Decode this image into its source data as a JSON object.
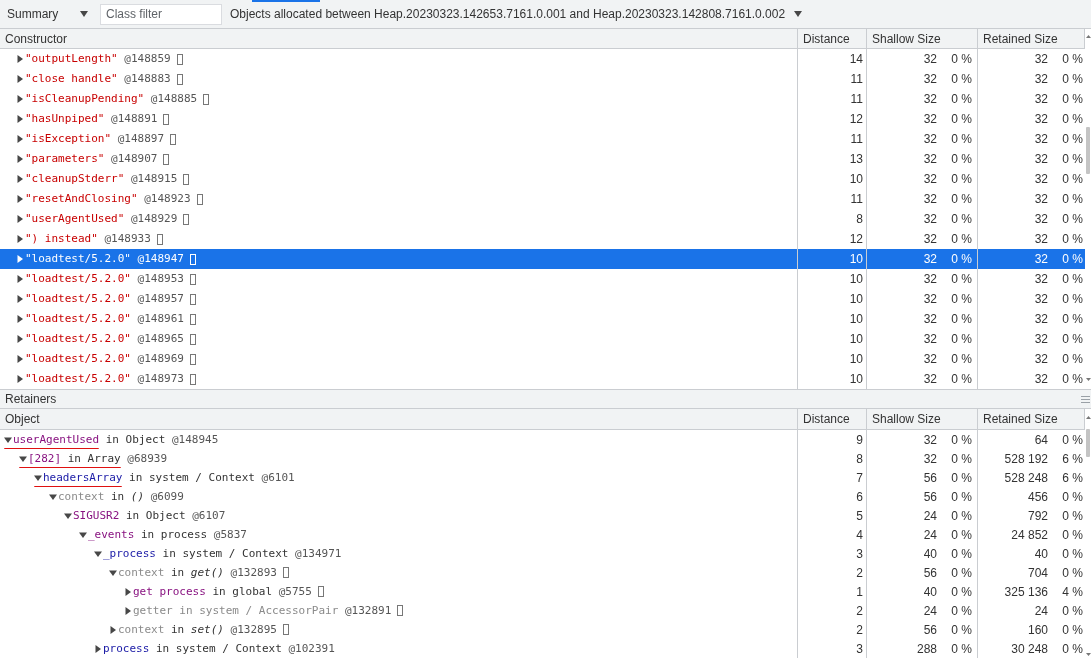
{
  "toolbar": {
    "view_select": "Summary",
    "class_filter": {
      "placeholder": "Class filter"
    },
    "range_select": "Objects allocated between Heap.20230323.142653.7161.0.001 and Heap.20230323.142808.7161.0.002"
  },
  "objects_table": {
    "columns": [
      "Constructor",
      "Distance",
      "Shallow Size",
      "Retained Size"
    ],
    "rows": [
      {
        "name": "\"outputLength\"",
        "id": "@148859",
        "box_icon": true,
        "expanded": false,
        "selected": false,
        "distance": "14",
        "shallow_size": "32",
        "shallow_percent": "0 %",
        "retained_size": "32",
        "retained_percent": "0 %"
      },
      {
        "name": "\"close handle\"",
        "id": "@148883",
        "box_icon": true,
        "expanded": false,
        "selected": false,
        "distance": "11",
        "shallow_size": "32",
        "shallow_percent": "0 %",
        "retained_size": "32",
        "retained_percent": "0 %"
      },
      {
        "name": "\"isCleanupPending\"",
        "id": "@148885",
        "box_icon": true,
        "expanded": false,
        "selected": false,
        "distance": "11",
        "shallow_size": "32",
        "shallow_percent": "0 %",
        "retained_size": "32",
        "retained_percent": "0 %"
      },
      {
        "name": "\"hasUnpiped\"",
        "id": "@148891",
        "box_icon": true,
        "expanded": false,
        "selected": false,
        "distance": "12",
        "shallow_size": "32",
        "shallow_percent": "0 %",
        "retained_size": "32",
        "retained_percent": "0 %"
      },
      {
        "name": "\"isException\"",
        "id": "@148897",
        "box_icon": true,
        "expanded": false,
        "selected": false,
        "distance": "11",
        "shallow_size": "32",
        "shallow_percent": "0 %",
        "retained_size": "32",
        "retained_percent": "0 %"
      },
      {
        "name": "\"parameters\"",
        "id": "@148907",
        "box_icon": true,
        "expanded": false,
        "selected": false,
        "distance": "13",
        "shallow_size": "32",
        "shallow_percent": "0 %",
        "retained_size": "32",
        "retained_percent": "0 %"
      },
      {
        "name": "\"cleanupStderr\"",
        "id": "@148915",
        "box_icon": true,
        "expanded": false,
        "selected": false,
        "distance": "10",
        "shallow_size": "32",
        "shallow_percent": "0 %",
        "retained_size": "32",
        "retained_percent": "0 %"
      },
      {
        "name": "\"resetAndClosing\"",
        "id": "@148923",
        "box_icon": true,
        "expanded": false,
        "selected": false,
        "distance": "11",
        "shallow_size": "32",
        "shallow_percent": "0 %",
        "retained_size": "32",
        "retained_percent": "0 %"
      },
      {
        "name": "\"userAgentUsed\"",
        "id": "@148929",
        "box_icon": true,
        "expanded": false,
        "selected": false,
        "distance": "8",
        "shallow_size": "32",
        "shallow_percent": "0 %",
        "retained_size": "32",
        "retained_percent": "0 %"
      },
      {
        "name": "\") instead\"",
        "id": "@148933",
        "box_icon": true,
        "expanded": false,
        "selected": false,
        "distance": "12",
        "shallow_size": "32",
        "shallow_percent": "0 %",
        "retained_size": "32",
        "retained_percent": "0 %"
      },
      {
        "name": "\"loadtest/5.2.0\"",
        "id": "@148947",
        "box_icon": true,
        "expanded": false,
        "selected": true,
        "distance": "10",
        "shallow_size": "32",
        "shallow_percent": "0 %",
        "retained_size": "32",
        "retained_percent": "0 %"
      },
      {
        "name": "\"loadtest/5.2.0\"",
        "id": "@148953",
        "box_icon": true,
        "expanded": false,
        "selected": false,
        "distance": "10",
        "shallow_size": "32",
        "shallow_percent": "0 %",
        "retained_size": "32",
        "retained_percent": "0 %"
      },
      {
        "name": "\"loadtest/5.2.0\"",
        "id": "@148957",
        "box_icon": true,
        "expanded": false,
        "selected": false,
        "distance": "10",
        "shallow_size": "32",
        "shallow_percent": "0 %",
        "retained_size": "32",
        "retained_percent": "0 %"
      },
      {
        "name": "\"loadtest/5.2.0\"",
        "id": "@148961",
        "box_icon": true,
        "expanded": false,
        "selected": false,
        "distance": "10",
        "shallow_size": "32",
        "shallow_percent": "0 %",
        "retained_size": "32",
        "retained_percent": "0 %"
      },
      {
        "name": "\"loadtest/5.2.0\"",
        "id": "@148965",
        "box_icon": true,
        "expanded": false,
        "selected": false,
        "distance": "10",
        "shallow_size": "32",
        "shallow_percent": "0 %",
        "retained_size": "32",
        "retained_percent": "0 %"
      },
      {
        "name": "\"loadtest/5.2.0\"",
        "id": "@148969",
        "box_icon": true,
        "expanded": false,
        "selected": false,
        "distance": "10",
        "shallow_size": "32",
        "shallow_percent": "0 %",
        "retained_size": "32",
        "retained_percent": "0 %"
      },
      {
        "name": "\"loadtest/5.2.0\"",
        "id": "@148973",
        "box_icon": true,
        "expanded": false,
        "selected": false,
        "distance": "10",
        "shallow_size": "32",
        "shallow_percent": "0 %",
        "retained_size": "32",
        "retained_percent": "0 %"
      }
    ]
  },
  "retainers": {
    "title": "Retainers",
    "columns": [
      "Object",
      "Distance",
      "Shallow Size",
      "Retained Size"
    ],
    "rows": [
      {
        "name": "userAgentUsed",
        "kind": "property",
        "owner": "in Object",
        "id": "@148945",
        "box_icon": false,
        "expanded": true,
        "dimmed": false,
        "name_underlined": true,
        "owner_underlined": false,
        "distance": "9",
        "shallow_size": "32",
        "shallow_percent": "0 %",
        "retained_size": "64",
        "retained_percent": "0 %",
        "children": [
          {
            "name": "[282]",
            "kind": "property",
            "owner": "in Array",
            "id": "@68939",
            "box_icon": false,
            "expanded": true,
            "dimmed": false,
            "name_underlined": true,
            "owner_underlined": true,
            "distance": "8",
            "shallow_size": "32",
            "shallow_percent": "0 %",
            "retained_size": "528 192",
            "retained_percent": "6 %",
            "children": [
              {
                "name": "headersArray",
                "kind": "variable",
                "owner": "in system / Context",
                "id": "@6101",
                "box_icon": false,
                "expanded": true,
                "dimmed": false,
                "name_underlined": true,
                "owner_underlined": false,
                "distance": "7",
                "shallow_size": "56",
                "shallow_percent": "0 %",
                "retained_size": "528 248",
                "retained_percent": "6 %",
                "children": [
                  {
                    "name": "context",
                    "kind": "internal",
                    "owner": "in *()*",
                    "id": "@6099",
                    "box_icon": false,
                    "expanded": true,
                    "dimmed": false,
                    "name_underlined": false,
                    "owner_underlined": false,
                    "distance": "6",
                    "shallow_size": "56",
                    "shallow_percent": "0 %",
                    "retained_size": "456",
                    "retained_percent": "0 %",
                    "children": [
                      {
                        "name": "SIGUSR2",
                        "kind": "property",
                        "owner": "in Object",
                        "id": "@6107",
                        "box_icon": false,
                        "expanded": true,
                        "dimmed": false,
                        "name_underlined": false,
                        "owner_underlined": false,
                        "distance": "5",
                        "shallow_size": "24",
                        "shallow_percent": "0 %",
                        "retained_size": "792",
                        "retained_percent": "0 %",
                        "children": [
                          {
                            "name": "_events",
                            "kind": "property",
                            "owner": "in process",
                            "id": "@5837",
                            "box_icon": false,
                            "expanded": true,
                            "dimmed": false,
                            "name_underlined": false,
                            "owner_underlined": false,
                            "distance": "4",
                            "shallow_size": "24",
                            "shallow_percent": "0 %",
                            "retained_size": "24 852",
                            "retained_percent": "0 %",
                            "children": [
                              {
                                "name": "_process",
                                "kind": "variable",
                                "owner": "in system / Context",
                                "id": "@134971",
                                "box_icon": false,
                                "expanded": true,
                                "dimmed": false,
                                "name_underlined": false,
                                "owner_underlined": false,
                                "distance": "3",
                                "shallow_size": "40",
                                "shallow_percent": "0 %",
                                "retained_size": "40",
                                "retained_percent": "0 %",
                                "children": [
                                  {
                                    "name": "context",
                                    "kind": "internal",
                                    "owner": "in *get()*",
                                    "id": "@132893",
                                    "box_icon": true,
                                    "expanded": true,
                                    "dimmed": false,
                                    "name_underlined": false,
                                    "owner_underlined": false,
                                    "distance": "2",
                                    "shallow_size": "56",
                                    "shallow_percent": "0 %",
                                    "retained_size": "704",
                                    "retained_percent": "0 %",
                                    "children": [
                                      {
                                        "name": "get process",
                                        "kind": "property",
                                        "owner": "in global",
                                        "id": "@5755",
                                        "box_icon": true,
                                        "expanded": false,
                                        "dimmed": false,
                                        "name_underlined": false,
                                        "owner_underlined": false,
                                        "distance": "1",
                                        "shallow_size": "40",
                                        "shallow_percent": "0 %",
                                        "retained_size": "325 136",
                                        "retained_percent": "4 %"
                                      },
                                      {
                                        "name": "getter",
                                        "kind": "internal",
                                        "owner": "in system / AccessorPair",
                                        "id": "@132891",
                                        "box_icon": true,
                                        "expanded": false,
                                        "dimmed": true,
                                        "name_underlined": false,
                                        "owner_underlined": false,
                                        "distance": "2",
                                        "shallow_size": "24",
                                        "shallow_percent": "0 %",
                                        "retained_size": "24",
                                        "retained_percent": "0 %"
                                      }
                                    ]
                                  },
                                  {
                                    "name": "context",
                                    "kind": "internal",
                                    "owner": "in *set()*",
                                    "id": "@132895",
                                    "box_icon": true,
                                    "expanded": false,
                                    "dimmed": false,
                                    "name_underlined": false,
                                    "owner_underlined": false,
                                    "distance": "2",
                                    "shallow_size": "56",
                                    "shallow_percent": "0 %",
                                    "retained_size": "160",
                                    "retained_percent": "0 %"
                                  }
                                ]
                              },
                              {
                                "name": "process",
                                "kind": "variable",
                                "owner": "in system / Context",
                                "id": "@102391",
                                "box_icon": false,
                                "expanded": false,
                                "dimmed": false,
                                "name_underlined": false,
                                "owner_underlined": false,
                                "distance": "3",
                                "shallow_size": "288",
                                "shallow_percent": "0 %",
                                "retained_size": "30 248",
                                "retained_percent": "0 %"
                              }
                            ]
                          }
                        ]
                      }
                    ]
                  }
                ]
              }
            ]
          }
        ]
      }
    ]
  }
}
